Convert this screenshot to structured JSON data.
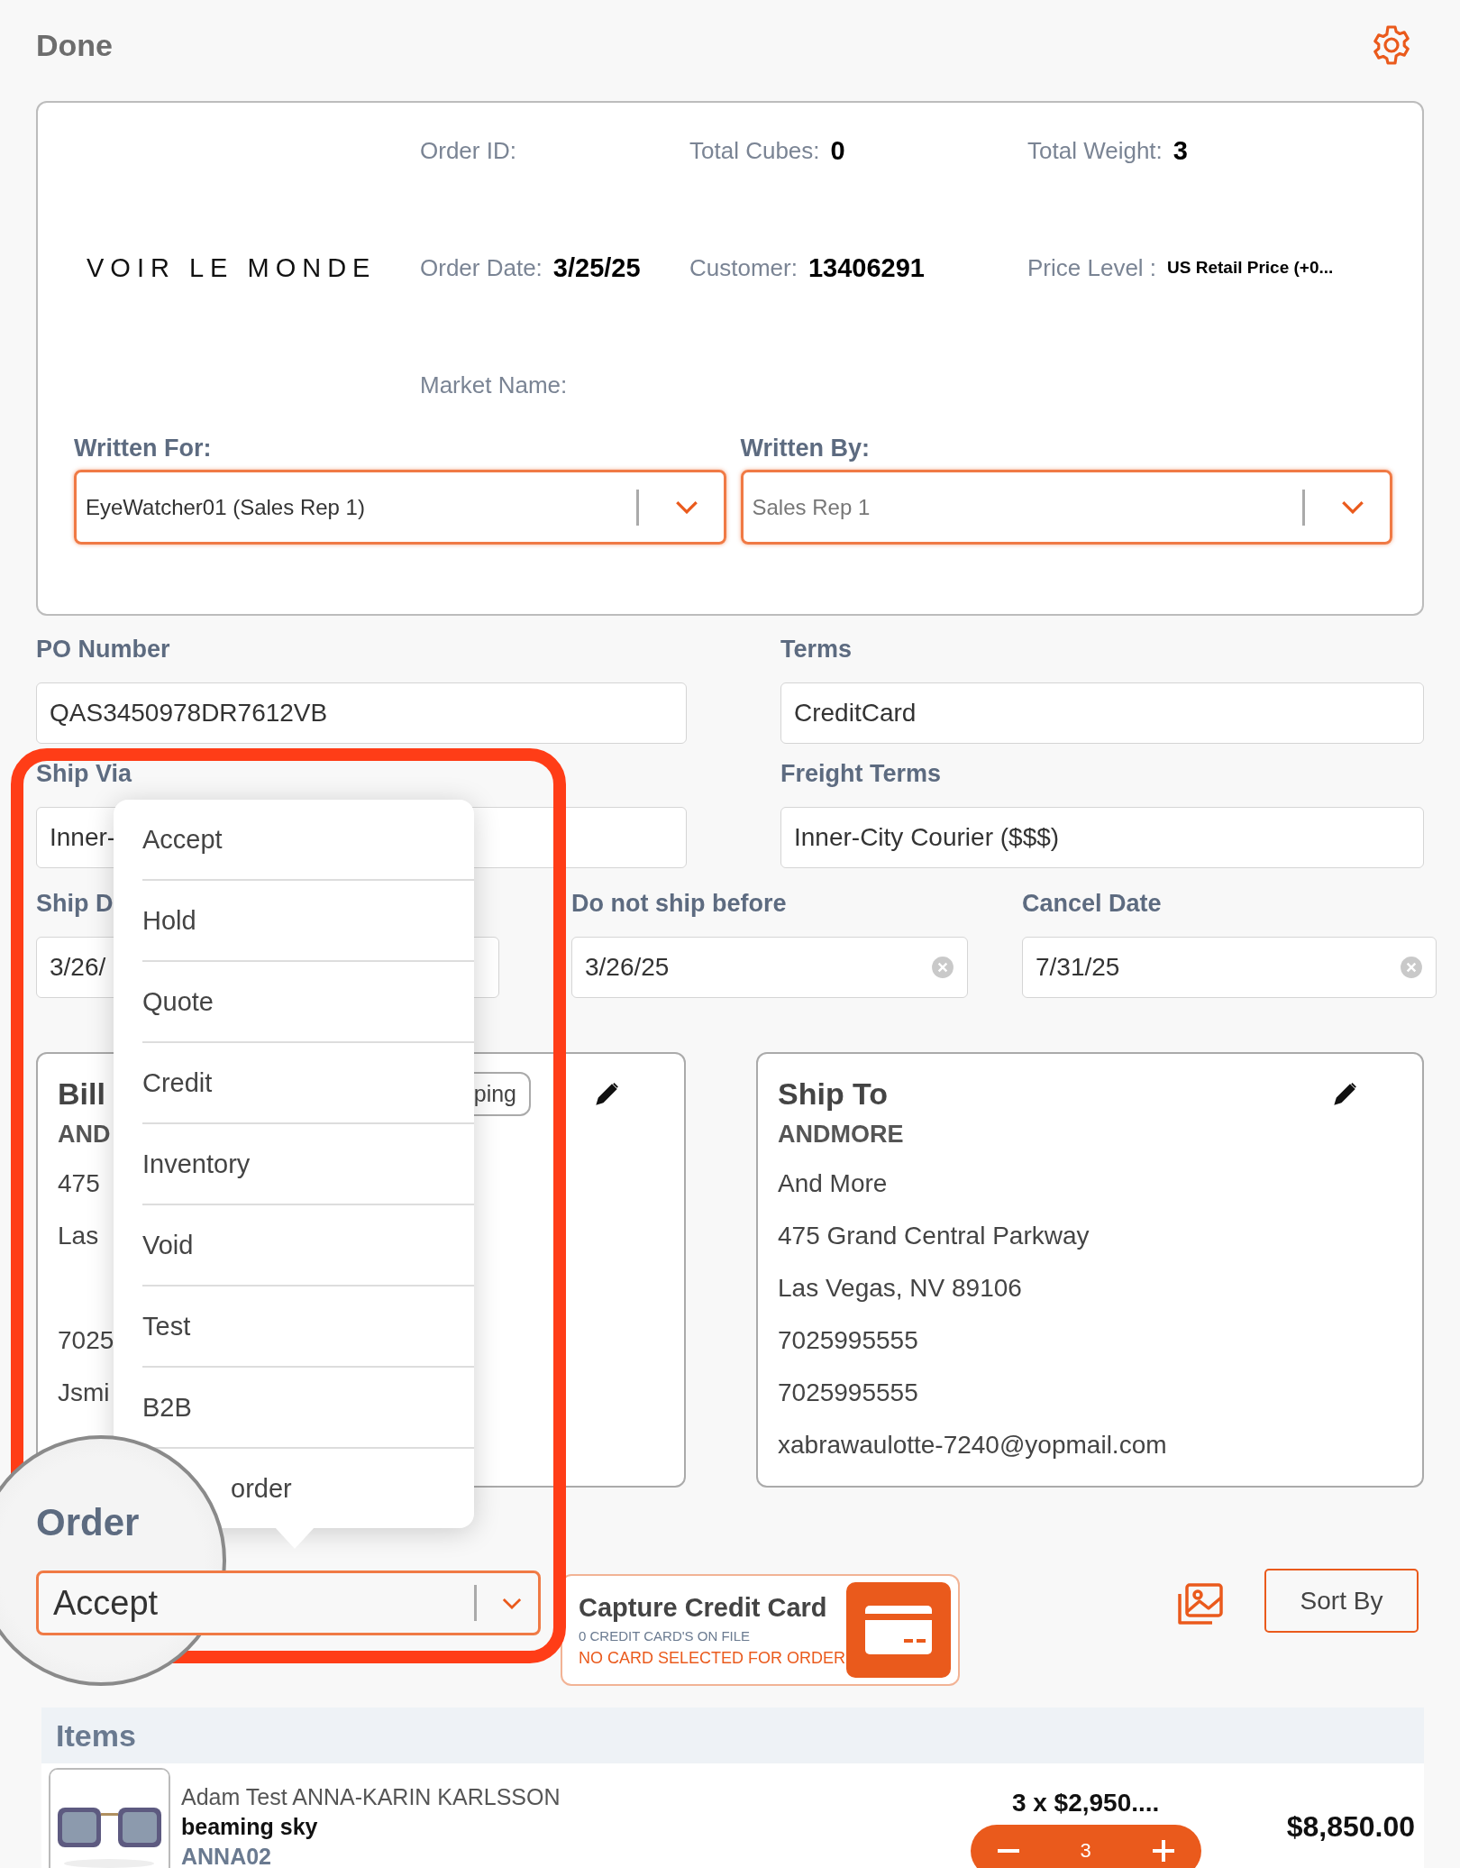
{
  "top_bar": {
    "title": "Done"
  },
  "order_summary": {
    "brand": "VOIR LE MONDE",
    "fields": [
      {
        "label": "Order ID:"
      },
      {
        "label": "Total Cubes:",
        "value": "0"
      },
      {
        "label": "Total Weight:",
        "value": "3"
      },
      {
        "label": "Order Date:",
        "value": "3/25/25"
      },
      {
        "label": "Customer:",
        "value": "13406291"
      },
      {
        "label": "Price Level :",
        "value": "US Retail Price (+0...",
        "kind": "small"
      },
      {
        "label": "Market Name:"
      }
    ],
    "written_for": {
      "label": "Written For:",
      "value": "EyeWatcher01 (Sales Rep 1)"
    },
    "written_by": {
      "label": "Written By:",
      "placeholder": "Sales Rep 1"
    }
  },
  "form": {
    "po_number": {
      "label": "PO Number",
      "value": "QAS3450978DR7612VB"
    },
    "terms": {
      "label": "Terms",
      "value": "CreditCard"
    },
    "ship_via": {
      "label": "Ship Via",
      "value": "Inner-"
    },
    "freight_terms": {
      "label": "Freight Terms",
      "value": "Inner-City Courier ($$$)"
    },
    "ship_date": {
      "label": "Ship D",
      "value": "3/26/"
    },
    "do_not_ship_before": {
      "label": "Do not ship before",
      "value": "3/26/25"
    },
    "cancel_date": {
      "label": "Cancel Date",
      "value": "7/31/25"
    }
  },
  "bill_to": {
    "title": "Bill",
    "name": "AND",
    "lines": [
      "475",
      "Las",
      "7025",
      "Jsmi"
    ],
    "button": "ping"
  },
  "ship_to": {
    "title": "Ship To",
    "name": "ANDMORE",
    "lines": [
      "And More",
      "475 Grand Central Parkway",
      "Las Vegas, NV  89106",
      "7025995555",
      "7025995555",
      "xabrawaulotte-7240@yopmail.com"
    ]
  },
  "status_menu": {
    "items": [
      "Accept",
      "Hold",
      "Quote",
      "Credit",
      "Inventory",
      "Void",
      "Test",
      "B2B",
      "order"
    ]
  },
  "order_status": {
    "label": "Order",
    "value": "Accept"
  },
  "credit_card": {
    "title": "Capture Credit Card",
    "on_file": "0 CREDIT CARD'S ON FILE",
    "status": "NO CARD SELECTED FOR ORDER"
  },
  "sort_button": "Sort By",
  "items": {
    "title": "Items",
    "rows": [
      {
        "kind": "picture",
        "brand": "Adam Test ANNA-KARIN KARLSSON",
        "name": "beaming sky",
        "sku": "ANNA02",
        "unit_price": "3 x $2,950....",
        "quantity": "3",
        "total": "$8,850.00"
      }
    ]
  }
}
